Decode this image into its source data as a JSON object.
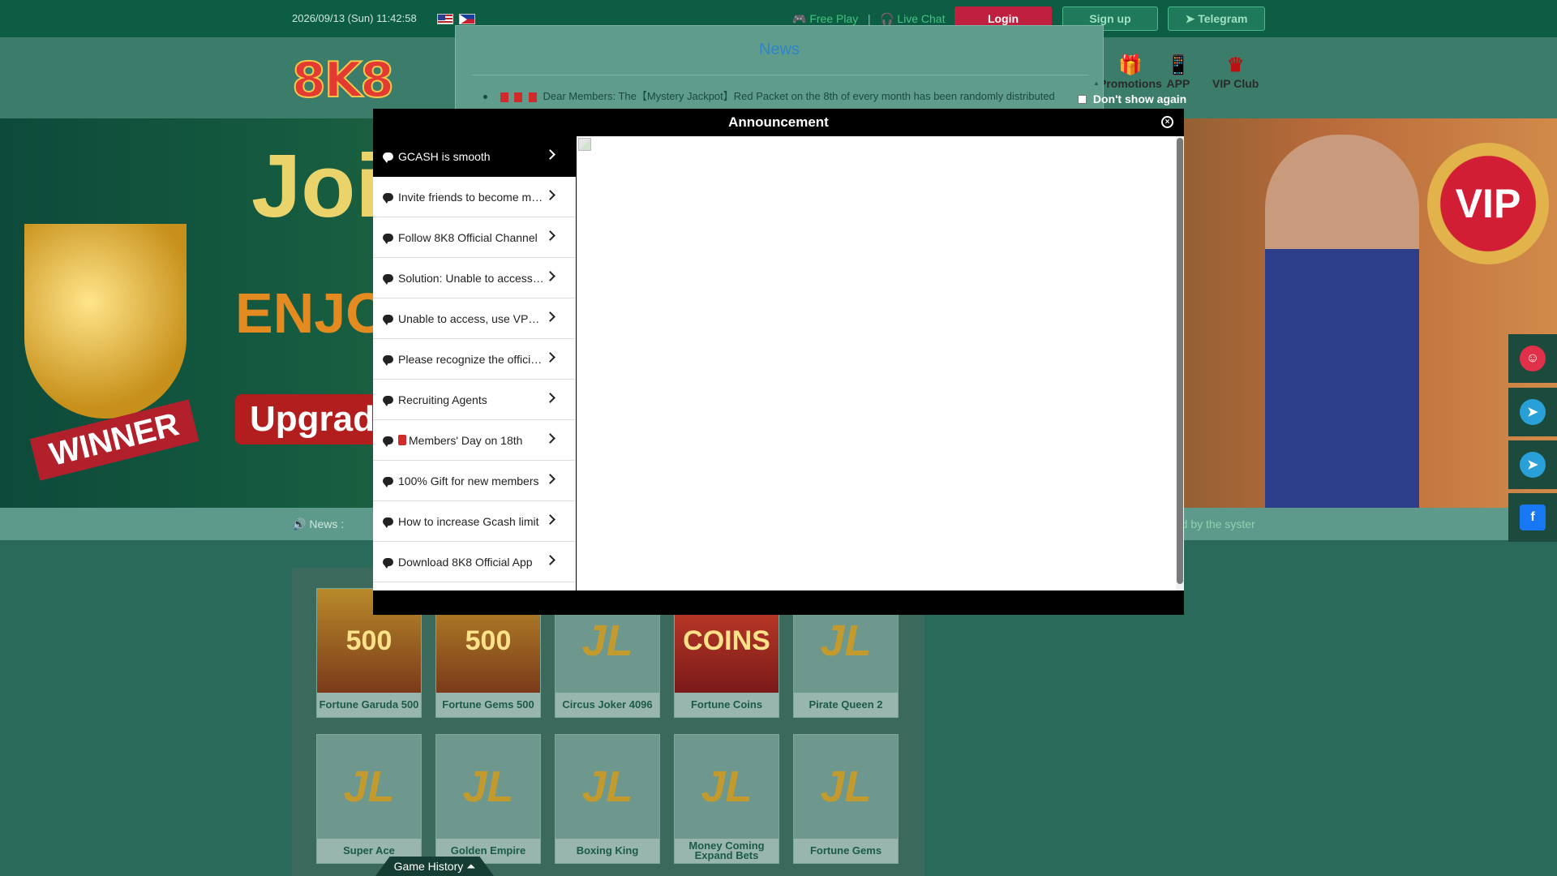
{
  "topbar": {
    "datetime": "2026/09/13 (Sun) 11:42:58",
    "free_play": "Free Play",
    "separator": "|",
    "live_chat": "Live Chat",
    "login": "Login",
    "signup": "Sign up",
    "telegram": "Telegram"
  },
  "header": {
    "logo_text": "8K8",
    "nav": [
      {
        "label": "Promotions",
        "icon": "gift-icon"
      },
      {
        "label": "APP",
        "icon": "phone-icon"
      },
      {
        "label": "VIP Club",
        "icon": "vip-icon"
      }
    ]
  },
  "banner": {
    "line1": "Joi",
    "line2": "ENJOY",
    "line3": "Upgrade",
    "ribbon": "WINNER",
    "badge": "VIP"
  },
  "newsbar": {
    "label": "News :",
    "tail": "ted by the syster"
  },
  "news_modal": {
    "title": "News",
    "item": "Dear Members: The【Mystery Jackpot】Red Packet on the 8th of every month has been randomly distributed",
    "dont_show": "Don't show again"
  },
  "announcement": {
    "title": "Announcement",
    "items": [
      {
        "label": "GCASH is smooth",
        "active": true
      },
      {
        "label": "Invite friends to become members"
      },
      {
        "label": "Follow 8K8 Official Channel"
      },
      {
        "label": "Solution: Unable to access the website"
      },
      {
        "label": "Unable to access, use VPN to visit"
      },
      {
        "label": "Please recognize the official website"
      },
      {
        "label": "Recruiting Agents"
      },
      {
        "label": "Members' Day on 18th",
        "red_packet": true
      },
      {
        "label": "100% Gift for new members"
      },
      {
        "label": "How to increase Gcash limit"
      },
      {
        "label": "Download 8K8 Official App"
      }
    ]
  },
  "games": [
    {
      "name": "Fortune Garuda 500",
      "art": "500"
    },
    {
      "name": "Fortune Gems 500",
      "art": "500"
    },
    {
      "name": "Circus Joker 4096",
      "art": "JL"
    },
    {
      "name": "Fortune Coins",
      "art": "COINS"
    },
    {
      "name": "Pirate Queen 2",
      "art": "JL"
    },
    {
      "name": "Super Ace",
      "art": "JL"
    },
    {
      "name": "Golden Empire",
      "art": "JL"
    },
    {
      "name": "Boxing King",
      "art": "JL"
    },
    {
      "name": "Money Coming Expand Bets",
      "art": "JL"
    },
    {
      "name": "Fortune Gems",
      "art": "JL"
    }
  ],
  "game_history": "Game History ⏶",
  "sidebar": [
    {
      "icon": "chat-support-icon",
      "color": "#e0304a",
      "glyph": "☺"
    },
    {
      "icon": "telegram-icon",
      "color": "#2aa0d9",
      "glyph": "➤"
    },
    {
      "icon": "telegram-icon",
      "color": "#2aa0d9",
      "glyph": "➤"
    },
    {
      "icon": "facebook-icon",
      "color": "#1877f2",
      "glyph": "f"
    }
  ]
}
